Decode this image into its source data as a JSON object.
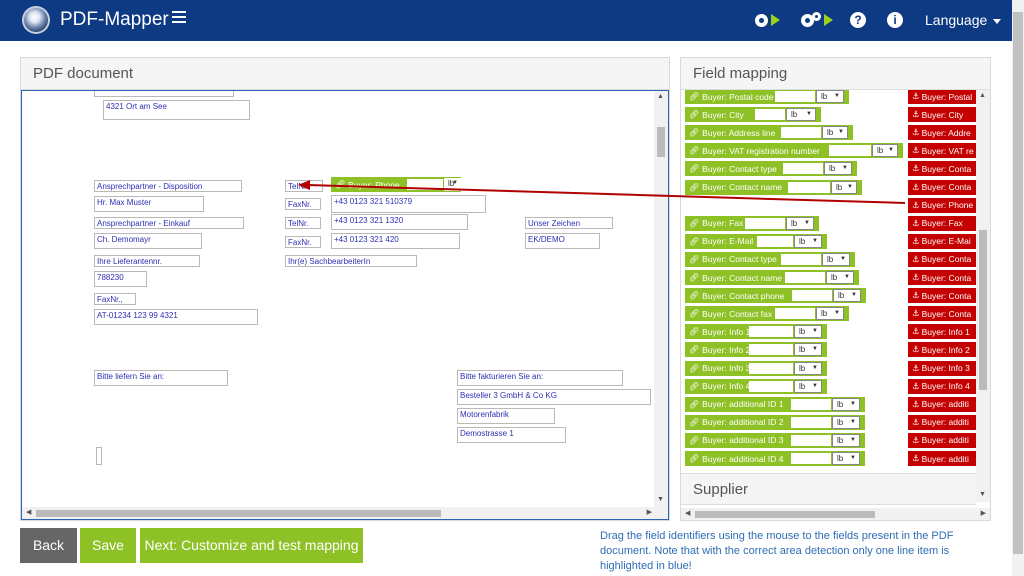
{
  "app": {
    "title": "PDF-Mapper",
    "language_label": "Language"
  },
  "pdf_panel": {
    "title": "PDF document",
    "boxes": [
      {
        "text": "4321 Ort am See"
      },
      {
        "text": "Ansprechpartner - Disposition"
      },
      {
        "text": "TelNr."
      },
      {
        "text": "Hr. Max Muster"
      },
      {
        "text": "FaxNr."
      },
      {
        "text": "+43 0123 321 510379"
      },
      {
        "text": "Ansprechpartner - Einkauf"
      },
      {
        "text": "TelNr."
      },
      {
        "text": "+43 0123 321 1320"
      },
      {
        "text": "Unser Zeichen"
      },
      {
        "text": "Ch. Demomayr"
      },
      {
        "text": "FaxNr."
      },
      {
        "text": "+43 0123 321 420"
      },
      {
        "text": "EK/DEMO"
      },
      {
        "text": "Ihre Lieferantennr."
      },
      {
        "text": "Ihr(e) SachbearbeiterIn"
      },
      {
        "text": "788230"
      },
      {
        "text": "FaxNr.,"
      },
      {
        "text": "AT-01234 123 99 4321"
      },
      {
        "text": "Bitte liefern Sie an:"
      },
      {
        "text": "Bitte fakturieren Sie an:"
      },
      {
        "text": "Besteller 3 GmbH & Co KG"
      },
      {
        "text": "Motorenfabrik"
      },
      {
        "text": "Demostrasse 1"
      }
    ],
    "placed_tag": {
      "label": "Buyer: Phone",
      "unit": "lb"
    }
  },
  "mapping_panel": {
    "title": "Field mapping",
    "fields": [
      {
        "label": "Buyer: Postal code",
        "unit": "lb",
        "mapped": "Buyer: Postal"
      },
      {
        "label": "Buyer: City",
        "unit": "lb",
        "mapped": "Buyer: City"
      },
      {
        "label": "Buyer: Address line",
        "unit": "lb",
        "mapped": "Buyer: Addre"
      },
      {
        "label": "Buyer: VAT registration number",
        "unit": "lb",
        "mapped": "Buyer: VAT re"
      },
      {
        "label": "Buyer: Contact type",
        "unit": "lb",
        "mapped": "Buyer: Conta"
      },
      {
        "label": "Buyer: Contact name",
        "unit": "lb",
        "mapped": "Buyer: Conta"
      },
      {
        "label": "",
        "unit": "",
        "mapped": "Buyer: Phone"
      },
      {
        "label": "Buyer: Fax",
        "unit": "lb",
        "mapped": "Buyer: Fax"
      },
      {
        "label": "Buyer: E-Mail",
        "unit": "lb",
        "mapped": "Buyer: E-Mai"
      },
      {
        "label": "Buyer: Contact type",
        "unit": "lb",
        "mapped": "Buyer: Conta"
      },
      {
        "label": "Buyer: Contact name",
        "unit": "lb",
        "mapped": "Buyer: Conta"
      },
      {
        "label": "Buyer: Contact phone",
        "unit": "lb",
        "mapped": "Buyer: Conta"
      },
      {
        "label": "Buyer: Contact fax",
        "unit": "lb",
        "mapped": "Buyer: Conta"
      },
      {
        "label": "Buyer: Info 1",
        "unit": "lb",
        "mapped": "Buyer: Info 1"
      },
      {
        "label": "Buyer: Info 2",
        "unit": "lb",
        "mapped": "Buyer: Info 2"
      },
      {
        "label": "Buyer: Info 3",
        "unit": "lb",
        "mapped": "Buyer: Info 3"
      },
      {
        "label": "Buyer: Info 4",
        "unit": "lb",
        "mapped": "Buyer: Info 4"
      },
      {
        "label": "Buyer: additional ID 1",
        "unit": "lb",
        "mapped": "Buyer: additi"
      },
      {
        "label": "Buyer: additional ID 2",
        "unit": "lb",
        "mapped": "Buyer: additi"
      },
      {
        "label": "Buyer: additional ID 3",
        "unit": "lb",
        "mapped": "Buyer: additi"
      },
      {
        "label": "Buyer: additional ID 4",
        "unit": "lb",
        "mapped": "Buyer: additi"
      }
    ],
    "supplier_title": "Supplier"
  },
  "buttons": {
    "back": "Back",
    "save": "Save",
    "next": "Next: Customize and test mapping"
  },
  "hint": "Drag the field identifiers using the mouse to the fields present in the PDF document. Note that with the correct area detection only one line item is highlighted in blue!",
  "colors": {
    "topbar": "#0d3a82",
    "green": "#8ec126",
    "red": "#c40000",
    "link": "#2f6db5",
    "arrow": "#b00000"
  },
  "icons": {
    "link": "link-icon",
    "anchor": "anchor-icon",
    "settings_run": "gear-play-icon",
    "settings_multi": "gears-play-icon",
    "help": "help-icon",
    "info": "info-icon"
  }
}
